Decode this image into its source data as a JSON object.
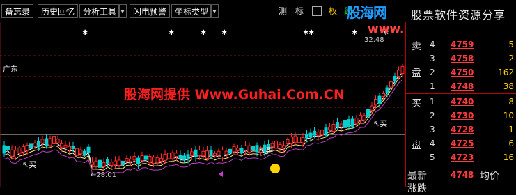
{
  "toolbar": {
    "buttons": [
      "备忘录",
      "历史回忆",
      "分析工具",
      "闪电预警",
      "坐标类型"
    ],
    "right_buttons": [
      "测",
      "标",
      "权",
      "线"
    ]
  },
  "watermark": {
    "brand_cn": "股海网",
    "brand_sub": "股票软件资源分享",
    "url": "www.Guhai.com.cn",
    "center_text": "股海网提供 Www.Guhai.Com.CN"
  },
  "chart": {
    "region_label": "广东",
    "top_value_label": "32.48",
    "low_value_label": "28.01",
    "buy_marker": "买",
    "colors": {
      "up": "#ff2a2a",
      "down": "#00d0d0",
      "ma_yellow": "#ffef80",
      "ma_purple": "#c040c0",
      "ma_white": "#ffffff"
    }
  },
  "order_book": {
    "sell_label_1": "卖",
    "sell_label_2": "盘",
    "buy_label_1": "买",
    "buy_label_2": "盘",
    "sell": [
      {
        "level": "4",
        "price": "4759",
        "volume": "5"
      },
      {
        "level": "3",
        "price": "4758",
        "volume": "2"
      },
      {
        "level": "2",
        "price": "4750",
        "volume": "162"
      },
      {
        "level": "1",
        "price": "4748",
        "volume": "38"
      }
    ],
    "buy": [
      {
        "level": "1",
        "price": "4740",
        "volume": "8"
      },
      {
        "level": "2",
        "price": "4730",
        "volume": "10"
      },
      {
        "level": "3",
        "price": "4728",
        "volume": "1"
      },
      {
        "level": "4",
        "price": "4725",
        "volume": "6"
      },
      {
        "level": "5",
        "price": "4723",
        "volume": "16"
      }
    ],
    "latest_label": "最新",
    "latest_price": "4748",
    "avg_label": "均价",
    "change_label": "涨跌"
  }
}
